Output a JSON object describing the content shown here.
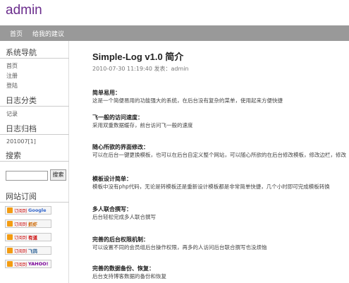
{
  "site": {
    "title": "admin"
  },
  "nav": {
    "items": [
      "首页",
      "给我的建议"
    ]
  },
  "sidebar": {
    "nav_title": "系统导航",
    "nav_links": [
      "首页",
      "注册",
      "登陆"
    ],
    "category_title": "日志分类",
    "category_links": [
      "记录"
    ],
    "archive_title": "日志归档",
    "archive_links": [
      "201007[1]"
    ],
    "search_title": "搜索",
    "search_placeholder": "",
    "search_button": "搜索",
    "rss_title": "网站订阅",
    "rss_buttons": [
      {
        "prefix": "订阅到",
        "brand": "Google",
        "brand_color": "#3366cc"
      },
      {
        "prefix": "订阅到",
        "brand": "抓虾",
        "brand_color": "#cc6600"
      },
      {
        "prefix": "订阅到",
        "brand": "有道",
        "brand_color": "#cc0000"
      },
      {
        "prefix": "订阅到",
        "brand": "飞鸽",
        "brand_color": "#336699"
      },
      {
        "prefix": "订阅到",
        "brand": "YAHOO!",
        "brand_color": "#7b0099"
      }
    ]
  },
  "post": {
    "title": "Simple-Log v1.0 简介",
    "meta": "2010-07-30 11:19:40 发表：admin",
    "sections": [
      {
        "heading": "简单易用：",
        "body": "这是一个简便易用的功能强大的系统，在后台没有复杂的菜单，使用起来方便快捷"
      },
      {
        "heading": "飞一般的访问速度：",
        "body": "采用双重数据缓存，前台访问飞一般的速度"
      },
      {
        "heading": "随心所欲的界面修改：",
        "body": "可以在后台一键更换模板，也可以在后台自定义整个网站，可以随心所欲的在后台修改模板，修改边栏，修改"
      },
      {
        "heading": "模板设计简单：",
        "body": "模板中没有php代码，无论是转模板还是重新设计模板都是非常简单快捷，几个小时即可完成模板转换"
      },
      {
        "heading": "多人联合撰写：",
        "body": "后台轻松完成多人联合撰写"
      },
      {
        "heading": "完善的后台权限机制：",
        "body": "可以设置不同的会员组后台操作权限，再多的人访问后台联合撰写也没烦恼"
      },
      {
        "heading": "完善的数据备份、恢复：",
        "body": "后台支持博客数据的备份和恢复"
      }
    ]
  }
}
